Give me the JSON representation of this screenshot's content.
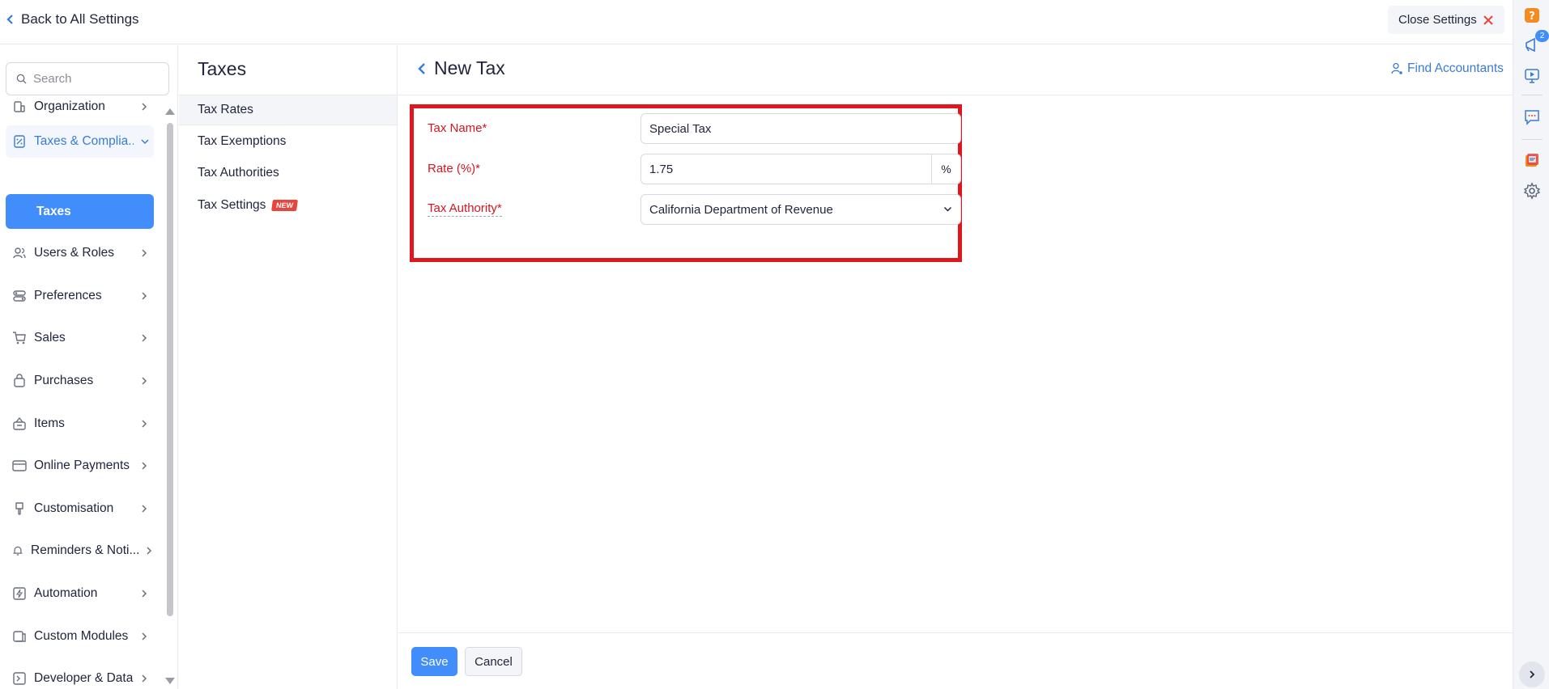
{
  "topbar": {
    "back_label": "Back to All Settings",
    "close_label": "Close Settings"
  },
  "sidebar": {
    "search_placeholder": "Search",
    "items": [
      {
        "label": "Organization",
        "icon": "organization-icon"
      },
      {
        "label": "Taxes & Complia...",
        "icon": "taxes-icon",
        "expanded": true
      },
      {
        "label": "Users & Roles",
        "icon": "users-icon"
      },
      {
        "label": "Preferences",
        "icon": "preferences-icon"
      },
      {
        "label": "Sales",
        "icon": "cart-icon"
      },
      {
        "label": "Purchases",
        "icon": "bag-icon"
      },
      {
        "label": "Items",
        "icon": "basket-icon"
      },
      {
        "label": "Online Payments",
        "icon": "card-icon"
      },
      {
        "label": "Customisation",
        "icon": "brush-icon"
      },
      {
        "label": "Reminders & Noti...",
        "icon": "bell-icon"
      },
      {
        "label": "Automation",
        "icon": "automation-icon"
      },
      {
        "label": "Custom Modules",
        "icon": "modules-icon"
      },
      {
        "label": "Developer & Data",
        "icon": "terminal-icon"
      }
    ],
    "sub_item": "Taxes"
  },
  "subnav": {
    "title": "Taxes",
    "items": [
      {
        "label": "Tax Rates",
        "active": true
      },
      {
        "label": "Tax Exemptions"
      },
      {
        "label": "Tax Authorities"
      },
      {
        "label": "Tax Settings",
        "badge": "NEW"
      }
    ]
  },
  "main": {
    "title": "New Tax",
    "find_accountants": "Find Accountants",
    "form": {
      "tax_name_label": "Tax Name*",
      "tax_name_value": "Special Tax",
      "rate_label": "Rate (%)*",
      "rate_value": "1.75",
      "rate_suffix": "%",
      "authority_label": "Tax Authority*",
      "authority_value": "California Department of Revenue"
    },
    "save_label": "Save",
    "cancel_label": "Cancel"
  },
  "rightbar": {
    "notification_count": "2",
    "icons": [
      "help-icon",
      "announcement-icon",
      "video-icon",
      "chat-icon",
      "apps-icon",
      "settings-icon"
    ]
  },
  "colors": {
    "accent": "#408dfb",
    "link": "#3a7bd5",
    "required": "#d4151e",
    "highlight_border": "#e0161f",
    "help": "#f58b1f"
  }
}
